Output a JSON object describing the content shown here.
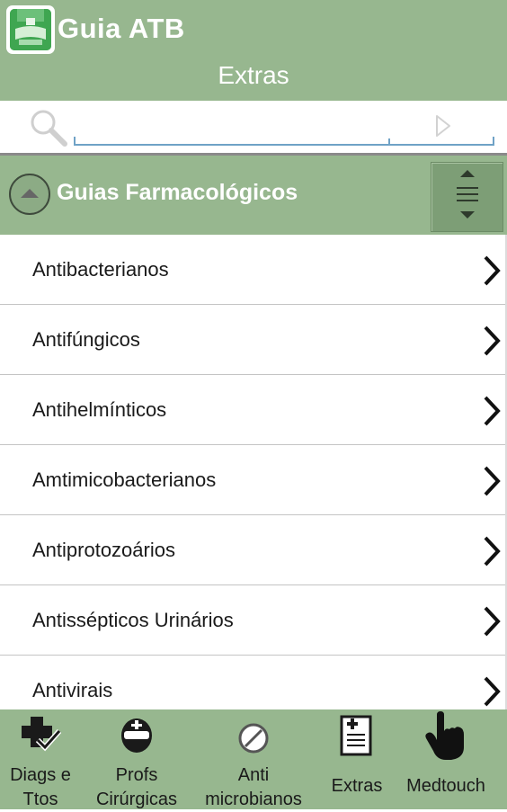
{
  "app": {
    "title": "Guia ATB"
  },
  "page": {
    "title": "Extras"
  },
  "search": {
    "placeholder": "",
    "value": ""
  },
  "section": {
    "title": "Guias Farmacológicos"
  },
  "list": {
    "items": [
      {
        "label": "Antibacterianos"
      },
      {
        "label": "Antifúngicos"
      },
      {
        "label": "Antihelmínticos"
      },
      {
        "label": "Amtimicobacterianos"
      },
      {
        "label": "Antiprotozoários"
      },
      {
        "label": "Antissépticos Urinários"
      },
      {
        "label": "Antivirais"
      }
    ]
  },
  "tabs": [
    {
      "label": "Diags e\nTtos",
      "icon": "medical-cross-check-icon"
    },
    {
      "label": "Profs\nCirúrgicas",
      "icon": "surgeon-icon"
    },
    {
      "label": "Anti\nmicrobianos",
      "icon": "pill-icon"
    },
    {
      "label": "Extras",
      "icon": "document-icon"
    },
    {
      "label": "Medtouch",
      "icon": "hand-pointer-icon"
    }
  ],
  "colors": {
    "header_bg": "#97b78f",
    "accent_line": "#6fa2c6",
    "text_dark": "#1a1a1a"
  }
}
